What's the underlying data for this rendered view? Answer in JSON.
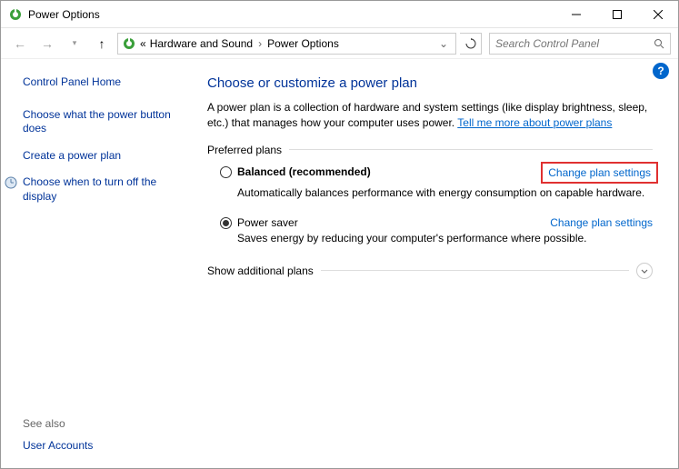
{
  "window": {
    "title": "Power Options"
  },
  "nav": {
    "breadcrumb": [
      "Hardware and Sound",
      "Power Options"
    ],
    "search_placeholder": "Search Control Panel"
  },
  "sidebar": {
    "home": "Control Panel Home",
    "links": [
      "Choose what the power button does",
      "Create a power plan",
      "Choose when to turn off the display"
    ],
    "see_also_label": "See also",
    "see_also_links": [
      "User Accounts"
    ]
  },
  "main": {
    "heading": "Choose or customize a power plan",
    "description": "A power plan is a collection of hardware and system settings (like display brightness, sleep, etc.) that manages how your computer uses power. ",
    "desc_link": "Tell me more about power plans",
    "preferred_label": "Preferred plans",
    "plans": [
      {
        "name": "Balanced (recommended)",
        "desc": "Automatically balances performance with energy consumption on capable hardware.",
        "link": "Change plan settings",
        "selected": false,
        "bold": true,
        "highlight": true
      },
      {
        "name": "Power saver",
        "desc": "Saves energy by reducing your computer's performance where possible.",
        "link": "Change plan settings",
        "selected": true,
        "bold": false,
        "highlight": false
      }
    ],
    "expand_label": "Show additional plans"
  }
}
